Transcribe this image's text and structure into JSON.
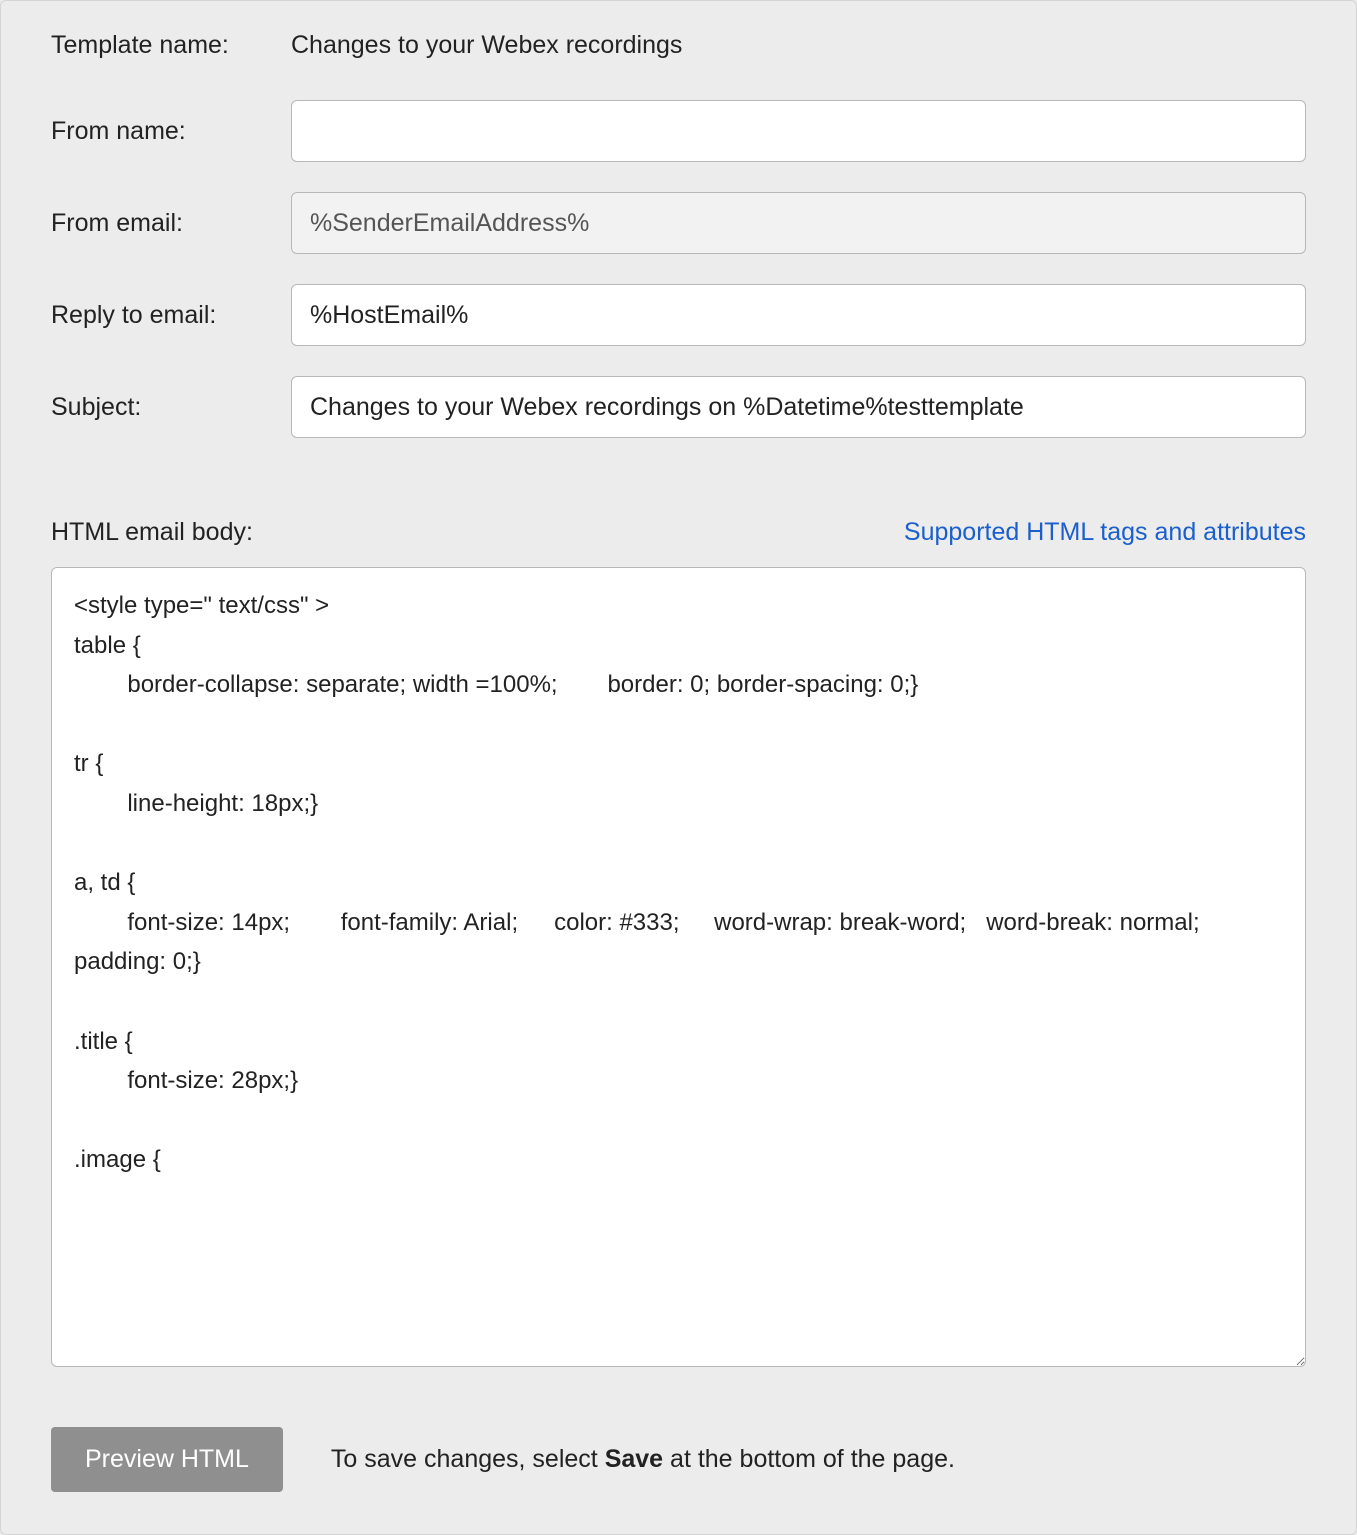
{
  "labels": {
    "template_name": "Template name:",
    "from_name": "From name:",
    "from_email": "From email:",
    "reply_to_email": "Reply to email:",
    "subject": "Subject:",
    "html_email_body": "HTML email body:",
    "supported_tags_link": "Supported HTML tags and attributes",
    "preview_button": "Preview HTML",
    "save_hint_prefix": "To save changes, select ",
    "save_hint_bold": "Save",
    "save_hint_suffix": " at the bottom of the page."
  },
  "values": {
    "template_name": "Changes to your Webex recordings",
    "from_name": "",
    "from_email": "%SenderEmailAddress%",
    "reply_to_email": "%HostEmail%",
    "subject": "Changes to your Webex recordings on %Datetime%testtemplate",
    "html_body": "<style type=\" text/css\" >\ntable {\n\tborder-collapse: separate; width =100%;\tborder: 0; border-spacing: 0;}\n\ntr {\n\tline-height: 18px;}\n\na, td {\n\tfont-size: 14px;\tfont-family: Arial;\tcolor: #333;\tword-wrap: break-word;   word-break: normal;\tpadding: 0;}\n\n.title {\n\tfont-size: 28px;}\n\n.image {"
  }
}
